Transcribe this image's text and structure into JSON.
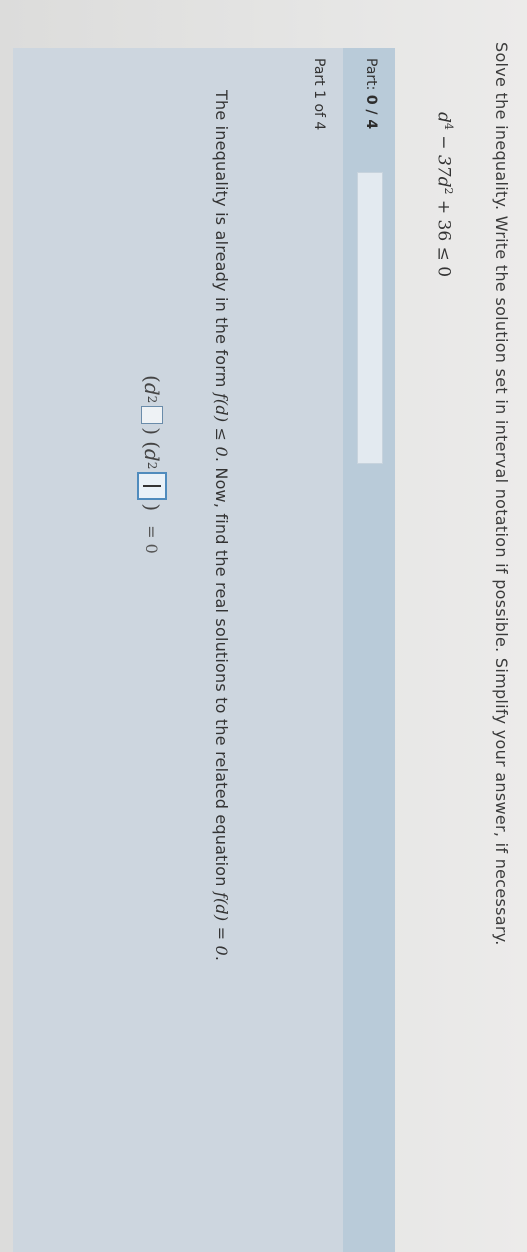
{
  "question": {
    "prompt": "Solve the inequality. Write the solution set in interval notation if possible. Simplify your answer, if necessary.",
    "expression": {
      "term1": "d",
      "exp1": "4",
      "term2": "− 37d",
      "exp2": "2",
      "tail": "+ 36 ≤ 0"
    }
  },
  "part": {
    "label_prefix": "Part: ",
    "progress": "0 / 4",
    "progress_fraction": 0
  },
  "step": {
    "label": "Part 1 of 4",
    "instruction_a": "The inequality is already in the form ",
    "instruction_math_a": "f(d) ≤ 0",
    "instruction_b": ". Now, find the real solutions to the related equation ",
    "instruction_math_b": "f(d) = 0",
    "instruction_c": "."
  },
  "equation": {
    "open1": "(",
    "var1": "d",
    "exp1": "2",
    "close1": ")",
    "open2": "(",
    "var2": "d",
    "exp2": "2",
    "close2": ")",
    "rhs": "= 0"
  }
}
